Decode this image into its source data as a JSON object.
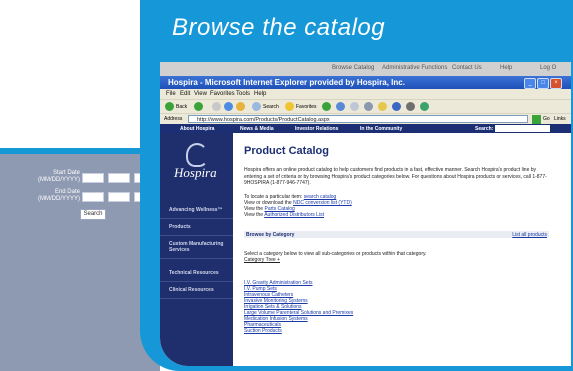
{
  "caption": "Browse the catalog",
  "bg_form": {
    "start_label_1": "Start Date",
    "start_label_2": "(MM/DD/YYYY)",
    "end_label_1": "End Date",
    "end_label_2": "(MM/DD/YYYY)",
    "search_button": "Search"
  },
  "outer_toolbar": {
    "links": [
      "Browse Catalog",
      "Administrative Functions",
      "Contact Us",
      "Help",
      "Log O"
    ]
  },
  "browser": {
    "title": "Hospira - Microsoft Internet Explorer provided by Hospira, Inc.",
    "menu": [
      "File",
      "Edit",
      "View",
      "Favorites",
      "Tools",
      "Help"
    ],
    "back_label": "Back",
    "search_label": "Search",
    "favorites_label": "Favorites",
    "address_label": "Address",
    "url": "http://www.hospira.com/Products/ProductCatalog.aspx",
    "go_label": "Go",
    "links_label": "Links"
  },
  "site_nav": {
    "items": [
      "About Hospira",
      "News & Media",
      "Investor Relations",
      "In the Community"
    ],
    "search_label": "Search:"
  },
  "sidebar": {
    "logo": "Hospira",
    "items": [
      "Advancing Wellness™",
      "Products",
      "Custom Manufacturing Services",
      "Technical Resources",
      "Clinical Resources"
    ]
  },
  "content": {
    "title": "Product Catalog",
    "intro": "Hospira offers an online product catalog to help customers find products in a fast, effective manner. Search Hospira's product line by entering a set of criteria or by browsing Hospira's product categories below. For questions about Hospira products or services, call 1-877-9HOSPIRA (1-877-946-7747).",
    "locate_text": "To locate a particular item:",
    "locate_link": "search catalog",
    "view_text_1": "View or download the",
    "view_link_1": "NDC conversion list (YTD)",
    "view_text_2": "View the",
    "view_link_2": "Parts Catalog",
    "view_text_3": "View the",
    "view_link_3": "Authorized Distributors List",
    "browse_heading": "Browse by Category",
    "list_all": "List all products",
    "select_text": "Select a category below to view all sub-categories or products within that category.",
    "category_tree": "Category Tree +",
    "categories": [
      "I.V. Gravity Administration Sets",
      "I.V. Pump Sets",
      "Intravenous Catheters",
      "Invasive Monitoring Systems",
      "Irrigation Sets & Solutions",
      "Large Volume Parenteral Solutions and Premixes",
      "Medication Infusion Systems",
      "Pharmaceuticals",
      "Suction Products"
    ]
  },
  "colors": {
    "frame_blue": "#1597d8",
    "navy": "#1d2f74",
    "title_bar": "#2a5fc6"
  }
}
